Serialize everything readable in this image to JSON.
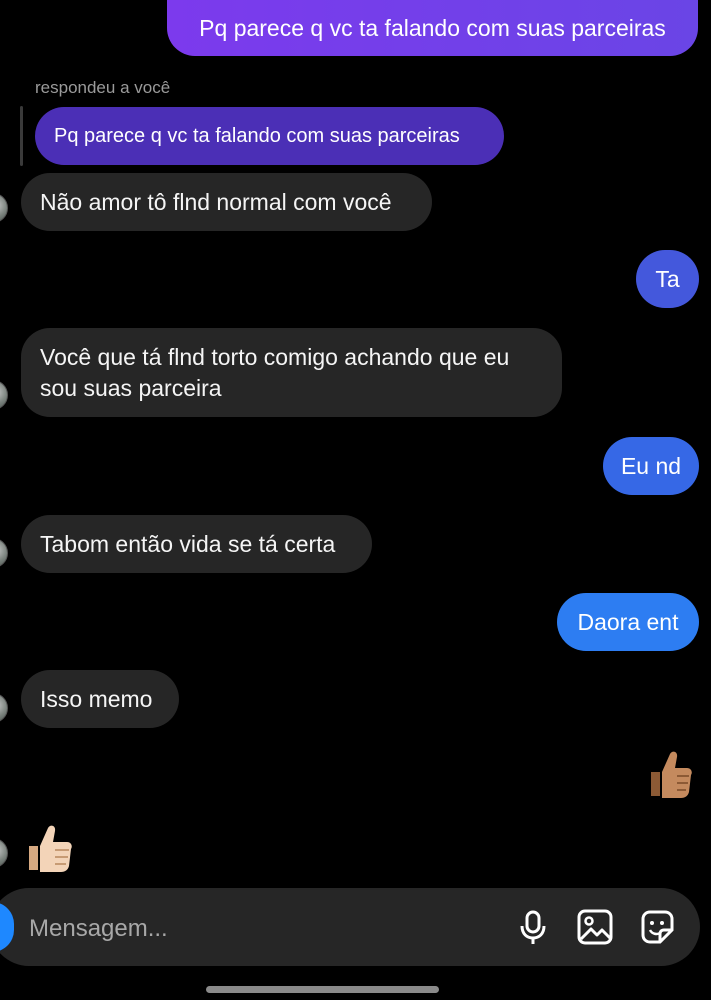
{
  "conversation": {
    "messages": [
      {
        "from": "me",
        "text": "Pq parece q vc ta falando com suas parceiras"
      },
      {
        "from": "them",
        "reply_label": "respondeu a você",
        "quoted": "Pq parece q vc ta falando com suas parceiras"
      },
      {
        "from": "them",
        "text": "Não amor tô flnd normal com você"
      },
      {
        "from": "me",
        "text": "Ta"
      },
      {
        "from": "them",
        "lines": [
          "Você que tá flnd torto comigo achando que eu",
          "sou suas parceira"
        ]
      },
      {
        "from": "me",
        "text": "Eu nd"
      },
      {
        "from": "them",
        "text": "Tabom então vida se tá certa"
      },
      {
        "from": "me",
        "text": "Daora ent"
      },
      {
        "from": "them",
        "text": "Isso memo"
      },
      {
        "from": "me",
        "emoji": "thumbs-up"
      },
      {
        "from": "them",
        "emoji": "thumbs-up"
      }
    ]
  },
  "composer": {
    "placeholder": "Mensagem...",
    "icons": [
      "camera-icon",
      "microphone-icon",
      "gallery-icon",
      "sticker-icon"
    ]
  },
  "colors": {
    "incoming_bubble": "#262626",
    "outgoing_purple": "#6a3ee0",
    "outgoing_indigo": "#4458dc",
    "outgoing_blue": "#2d7df2",
    "camera_button": "#1e88ff"
  }
}
